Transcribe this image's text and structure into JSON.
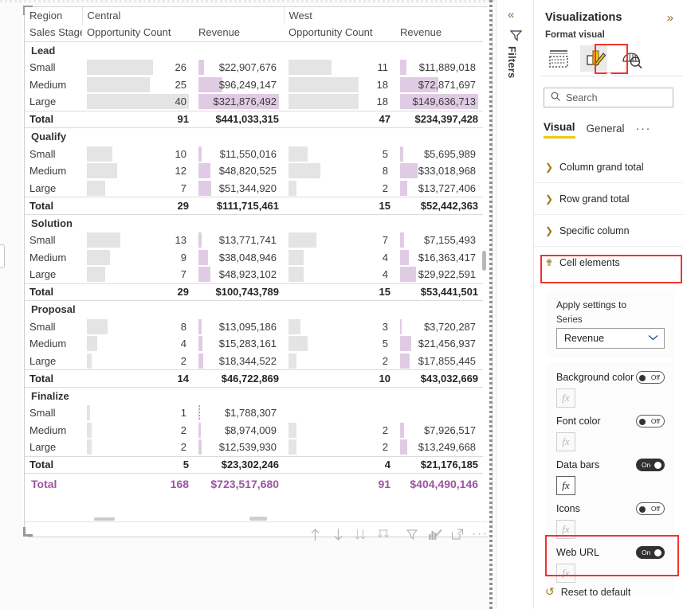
{
  "canvas": {
    "matrix": {
      "header": {
        "row1": [
          "Region",
          "Central",
          "",
          "West",
          ""
        ],
        "row2": [
          "Sales Stage",
          "Opportunity Count",
          "Revenue",
          "Opportunity Count",
          "Revenue"
        ]
      },
      "groups": [
        {
          "name": "Lead",
          "rows": [
            {
              "label": "Small",
              "central_count": "26",
              "central_count_pct": 65,
              "central_rev": "$22,907,676",
              "central_rev_pct": 7,
              "west_count": "11",
              "west_count_pct": 42,
              "west_rev": "$11,889,018",
              "west_rev_pct": 8
            },
            {
              "label": "Medium",
              "central_count": "25",
              "central_count_pct": 62,
              "central_rev": "$96,249,147",
              "central_rev_pct": 30,
              "west_count": "18",
              "west_count_pct": 69,
              "west_rev": "$72,871,697",
              "west_rev_pct": 49
            },
            {
              "label": "Large",
              "central_count": "40",
              "central_count_pct": 100,
              "central_rev": "$321,876,492",
              "central_rev_pct": 100,
              "west_count": "18",
              "west_count_pct": 69,
              "west_rev": "$149,636,713",
              "west_rev_pct": 100
            }
          ],
          "total": {
            "label": "Total",
            "central_count": "91",
            "central_rev": "$441,033,315",
            "west_count": "47",
            "west_rev": "$234,397,428"
          }
        },
        {
          "name": "Qualify",
          "rows": [
            {
              "label": "Small",
              "central_count": "10",
              "central_count_pct": 25,
              "central_rev": "$11,550,016",
              "central_rev_pct": 4,
              "west_count": "5",
              "west_count_pct": 19,
              "west_rev": "$5,695,989",
              "west_rev_pct": 4
            },
            {
              "label": "Medium",
              "central_count": "12",
              "central_count_pct": 30,
              "central_rev": "$48,820,525",
              "central_rev_pct": 15,
              "west_count": "8",
              "west_count_pct": 31,
              "west_rev": "$33,018,968",
              "west_rev_pct": 22
            },
            {
              "label": "Large",
              "central_count": "7",
              "central_count_pct": 18,
              "central_rev": "$51,344,920",
              "central_rev_pct": 16,
              "west_count": "2",
              "west_count_pct": 8,
              "west_rev": "$13,727,406",
              "west_rev_pct": 9
            }
          ],
          "total": {
            "label": "Total",
            "central_count": "29",
            "central_rev": "$111,715,461",
            "west_count": "15",
            "west_rev": "$52,442,363"
          }
        },
        {
          "name": "Solution",
          "rows": [
            {
              "label": "Small",
              "central_count": "13",
              "central_count_pct": 33,
              "central_rev": "$13,771,741",
              "central_rev_pct": 4,
              "west_count": "7",
              "west_count_pct": 27,
              "west_rev": "$7,155,493",
              "west_rev_pct": 5
            },
            {
              "label": "Medium",
              "central_count": "9",
              "central_count_pct": 23,
              "central_rev": "$38,048,946",
              "central_rev_pct": 12,
              "west_count": "4",
              "west_count_pct": 15,
              "west_rev": "$16,363,417",
              "west_rev_pct": 11
            },
            {
              "label": "Large",
              "central_count": "7",
              "central_count_pct": 18,
              "central_rev": "$48,923,102",
              "central_rev_pct": 15,
              "west_count": "4",
              "west_count_pct": 15,
              "west_rev": "$29,922,591",
              "west_rev_pct": 20
            }
          ],
          "total": {
            "label": "Total",
            "central_count": "29",
            "central_rev": "$100,743,789",
            "west_count": "15",
            "west_rev": "$53,441,501"
          }
        },
        {
          "name": "Proposal",
          "rows": [
            {
              "label": "Small",
              "central_count": "8",
              "central_count_pct": 20,
              "central_rev": "$13,095,186",
              "central_rev_pct": 4,
              "west_count": "3",
              "west_count_pct": 12,
              "west_rev": "$3,720,287",
              "west_rev_pct": 2
            },
            {
              "label": "Medium",
              "central_count": "4",
              "central_count_pct": 10,
              "central_rev": "$15,283,161",
              "central_rev_pct": 5,
              "west_count": "5",
              "west_count_pct": 19,
              "west_rev": "$21,456,937",
              "west_rev_pct": 14
            },
            {
              "label": "Large",
              "central_count": "2",
              "central_count_pct": 5,
              "central_rev": "$18,344,522",
              "central_rev_pct": 6,
              "west_count": "2",
              "west_count_pct": 8,
              "west_rev": "$17,855,445",
              "west_rev_pct": 12
            }
          ],
          "total": {
            "label": "Total",
            "central_count": "14",
            "central_rev": "$46,722,869",
            "west_count": "10",
            "west_rev": "$43,032,669"
          }
        },
        {
          "name": "Finalize",
          "rows": [
            {
              "label": "Small",
              "central_count": "1",
              "central_count_pct": 3,
              "central_rev": "$1,788,307",
              "central_rev_pct": 1,
              "west_count": "",
              "west_count_pct": 0,
              "west_rev": "",
              "west_rev_pct": 0
            },
            {
              "label": "Medium",
              "central_count": "2",
              "central_count_pct": 5,
              "central_rev": "$8,974,009",
              "central_rev_pct": 3,
              "west_count": "2",
              "west_count_pct": 8,
              "west_rev": "$7,926,517",
              "west_rev_pct": 5
            },
            {
              "label": "Large",
              "central_count": "2",
              "central_count_pct": 5,
              "central_rev": "$12,539,930",
              "central_rev_pct": 4,
              "west_count": "2",
              "west_count_pct": 8,
              "west_rev": "$13,249,668",
              "west_rev_pct": 9
            }
          ],
          "total": {
            "label": "Total",
            "central_count": "5",
            "central_rev": "$23,302,246",
            "west_count": "4",
            "west_rev": "$21,176,185"
          }
        }
      ],
      "grand_total": {
        "label": "Total",
        "central_count": "168",
        "central_rev": "$723,517,680",
        "west_count": "91",
        "west_rev": "$404,490,146"
      }
    },
    "visual_toolbar": [
      {
        "name": "drill-up-icon",
        "glyph": "↑"
      },
      {
        "name": "drill-down-icon",
        "glyph": "↓"
      },
      {
        "name": "expand-all-icon",
        "glyph": "↓↓"
      },
      {
        "name": "go-to-next-level-icon",
        "glyph": "↧"
      },
      {
        "name": "filter-icon",
        "glyph": "▽"
      },
      {
        "name": "edit-visual-icon",
        "glyph": "✐"
      },
      {
        "name": "focus-mode-icon",
        "glyph": "⇱"
      },
      {
        "name": "more-options-icon",
        "glyph": "⋯"
      }
    ]
  },
  "filters_rail": {
    "collapse_label": "«",
    "title": "Filters"
  },
  "viz_pane": {
    "title": "Visualizations",
    "expand_label": "»",
    "format_visual_label": "Format visual",
    "icons": [
      {
        "name": "build-visual-icon",
        "selected": false
      },
      {
        "name": "format-visual-icon",
        "selected": true
      },
      {
        "name": "analytics-icon",
        "selected": false
      }
    ],
    "search": {
      "placeholder": "Search",
      "value": ""
    },
    "tabs": [
      {
        "label": "Visual",
        "active": true
      },
      {
        "label": "General",
        "active": false
      }
    ],
    "tab_overflow": "···",
    "sections": [
      {
        "label": "Column grand total",
        "expanded": false
      },
      {
        "label": "Row grand total",
        "expanded": false
      },
      {
        "label": "Specific column",
        "expanded": false
      },
      {
        "label": "Cell elements",
        "expanded": true,
        "highlighted": true
      }
    ],
    "cell_elements": {
      "apply_settings_to": "Apply settings to",
      "series_label": "Series",
      "series_value": "Revenue",
      "properties": [
        {
          "label": "Background color",
          "state": "Off",
          "on": false,
          "fx_enabled": false
        },
        {
          "label": "Font color",
          "state": "Off",
          "on": false,
          "fx_enabled": false
        },
        {
          "label": "Data bars",
          "state": "On",
          "on": true,
          "fx_enabled": true
        },
        {
          "label": "Icons",
          "state": "Off",
          "on": false,
          "fx_enabled": false
        },
        {
          "label": "Web URL",
          "state": "On",
          "on": true,
          "fx_enabled": false,
          "highlighted": true
        }
      ],
      "fx_label": "fx"
    },
    "reset_label": "Reset to default"
  },
  "colors": {
    "accent_yellow": "#f2c811",
    "highlight_red": "#f2322f",
    "data_bar_gray": "#e4e4e4",
    "data_bar_purple": "#e0cbe4",
    "grand_total_text": "#9b55a3"
  }
}
